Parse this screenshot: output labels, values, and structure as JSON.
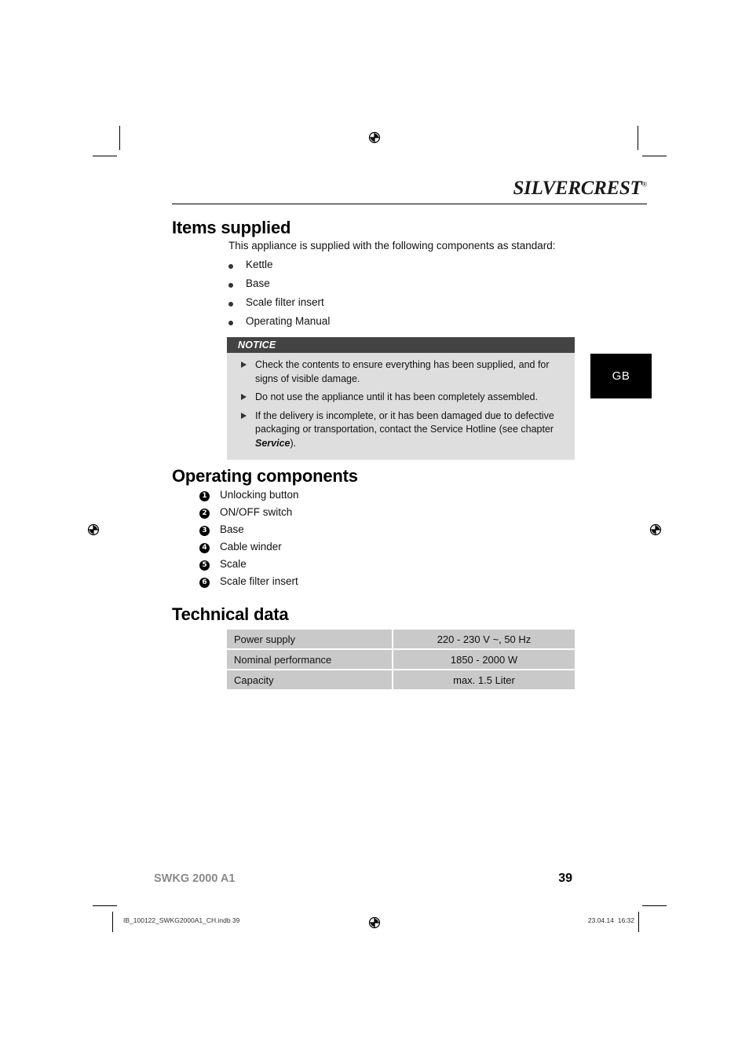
{
  "header": {
    "logo_text": "SILVERCREST",
    "logo_trademark": "®"
  },
  "language_tab": {
    "label": "GB"
  },
  "sections": {
    "items_supplied": {
      "heading": "Items supplied",
      "intro": "This appliance is supplied with the following components as standard:",
      "bullets": [
        "Kettle",
        "Base",
        "Scale filter insert",
        "Operating Manual"
      ]
    },
    "operating_components": {
      "heading": "Operating components",
      "items": [
        {
          "number": "1",
          "label": "Unlocking button"
        },
        {
          "number": "2",
          "label": "ON/OFF switch"
        },
        {
          "number": "3",
          "label": "Base"
        },
        {
          "number": "4",
          "label": "Cable winder"
        },
        {
          "number": "5",
          "label": "Scale"
        },
        {
          "number": "6",
          "label": "Scale filter insert"
        }
      ]
    },
    "technical_data": {
      "heading": "Technical data",
      "rows": [
        {
          "key": "Power supply",
          "value": "220 - 230 V ~, 50 Hz"
        },
        {
          "key": "Nominal performance",
          "value": "1850 - 2000 W"
        },
        {
          "key": "Capacity",
          "value": "max. 1.5 Liter"
        }
      ]
    }
  },
  "notice": {
    "title": "NOTICE",
    "items": [
      {
        "text_before": "Check the contents to ensure everything has been supplied, and for signs of visible damage.",
        "bold": "",
        "text_after": ""
      },
      {
        "text_before": "Do not use the appliance until it has been completely assembled.",
        "bold": "",
        "text_after": ""
      },
      {
        "text_before": "If the delivery is incomplete, or it has been damaged due to defective packaging or transportation, contact the Service Hotline (see chapter ",
        "bold": "Service",
        "text_after": ")."
      }
    ]
  },
  "footer": {
    "model": "SWKG 2000 A1",
    "page_number": "39"
  },
  "print_marks": {
    "file_name": "IB_100122_SWKG2000A1_CH.indb   39",
    "date": "23.04.14",
    "time": "16:32"
  },
  "colors": {
    "notice_header_bg": "#434343",
    "notice_body_bg": "#dedede",
    "table_cell_bg": "#c9c9c9",
    "lang_tab_bg": "#000000",
    "footer_model_color": "#8a8a8a"
  }
}
